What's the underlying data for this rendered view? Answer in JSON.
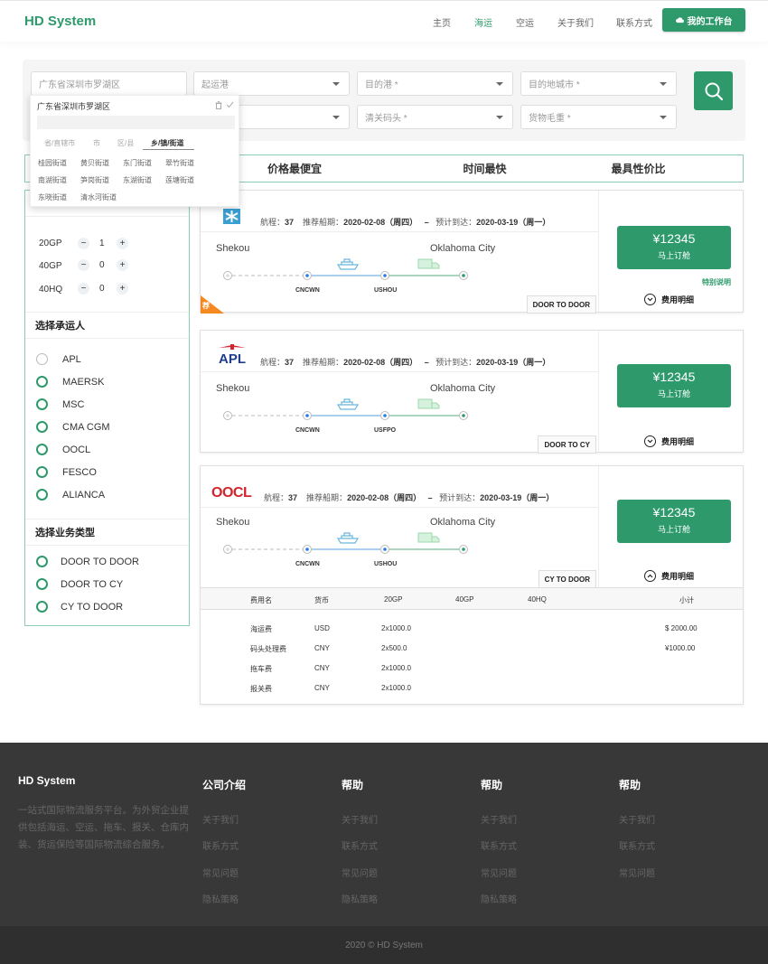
{
  "header": {
    "logo": "HD System",
    "nav": [
      {
        "label": "主页",
        "active": false
      },
      {
        "label": "海运",
        "active": true
      },
      {
        "label": "空运",
        "active": false
      },
      {
        "label": "关于我们",
        "active": false
      },
      {
        "label": "联系方式",
        "active": false
      }
    ],
    "workbench_label": "我的工作台",
    "accent_color": "#2e9a6c"
  },
  "search": {
    "origin_value": "广东省深圳市罗湖区",
    "origin_port_placeholder": "起运港",
    "dest_port_placeholder": "目的港 *",
    "dest_city_placeholder": "目的地城市 *",
    "row2_first_placeholder": "",
    "customs_placeholder": "清关码头 *",
    "weight_placeholder": "货物毛重 *",
    "search_icon": "search-icon"
  },
  "region_dropdown": {
    "title": "广东省深圳市罗湖区",
    "tabs": [
      "省/直辖市",
      "市",
      "区/县",
      "乡/镇/街道"
    ],
    "active_tab": 3,
    "items": [
      "桂园街道",
      "黄贝街道",
      "东门街道",
      "翠竹街道",
      "南湖街道",
      "笋岗街道",
      "东湖街道",
      "莲塘街道",
      "东晓街道",
      "清水河街道"
    ]
  },
  "sort_tabs": [
    "价格最便宜",
    "时间最快",
    "最具性价比"
  ],
  "sidebar": {
    "containers": [
      {
        "type": "20GP",
        "count": "1"
      },
      {
        "type": "40GP",
        "count": "0"
      },
      {
        "type": "40HQ",
        "count": "0"
      }
    ],
    "carrier_heading": "选择承运人",
    "carriers": [
      "APL",
      "MAERSK",
      "MSC",
      "CMA CGM",
      "OOCL",
      "FESCO",
      "ALIANCA"
    ],
    "business_heading": "选择业务类型",
    "business_types": [
      "DOOR TO DOOR",
      "DOOR TO CY",
      "CY TO DOOR"
    ]
  },
  "results": [
    {
      "carrier": "MAERSK",
      "voyage_label": "航程：",
      "voyage": "37",
      "sail_label": "推荐船期：",
      "sail_date": "2020-02-08（周四）",
      "dash": "–",
      "arrive_label": "预计到达：",
      "arrive_date": "2020-03-19（周一）",
      "from_city": "Shekou",
      "to_city": "Oklahoma City",
      "port1": "CNCWN",
      "port2": "USHOU",
      "service_type": "DOOR TO DOOR",
      "price": "¥12345",
      "book_label": "马上订舱",
      "special_note": "特别说明",
      "fee_toggle": "费用明细",
      "promo_badge": "荐"
    },
    {
      "carrier": "APL",
      "voyage_label": "航程：",
      "voyage": "37",
      "sail_label": "推荐船期：",
      "sail_date": "2020-02-08（周四）",
      "dash": "–",
      "arrive_label": "预计到达：",
      "arrive_date": "2020-03-19（周一）",
      "from_city": "Shekou",
      "to_city": "Oklahoma City",
      "port1": "CNCWN",
      "port2": "USFPO",
      "service_type": "DOOR TO CY",
      "price": "¥12345",
      "book_label": "马上订舱",
      "fee_toggle": "费用明细"
    },
    {
      "carrier": "OOCL",
      "voyage_label": "航程：",
      "voyage": "37",
      "sail_label": "推荐船期：",
      "sail_date": "2020-02-08（周四）",
      "dash": "–",
      "arrive_label": "预计到达：",
      "arrive_date": "2020-03-19（周一）",
      "from_city": "Shekou",
      "to_city": "Oklahoma City",
      "port1": "CNCWN",
      "port2": "USHOU",
      "service_type": "CY TO DOOR",
      "price": "¥12345",
      "book_label": "马上订舱",
      "fee_toggle": "费用明细",
      "fees": {
        "headers": [
          "费用名",
          "货币",
          "20GP",
          "40GP",
          "40HQ",
          "小计"
        ],
        "rows": [
          [
            "海运费",
            "USD",
            "2x1000.0",
            "",
            "",
            "$ 2000.00"
          ],
          [
            "码头处理费",
            "CNY",
            "2x500.0",
            "",
            "",
            "¥1000.00"
          ],
          [
            "拖车费",
            "CNY",
            "2x1000.0",
            "",
            "",
            ""
          ],
          [
            "报关费",
            "CNY",
            "2x1000.0",
            "",
            "",
            ""
          ]
        ]
      }
    }
  ],
  "footer": {
    "brand": "HD System",
    "description": "一站式国际物流服务平台。为外贸企业提供包括海运、空运、拖车、报关、仓库内装、货运保险等国际物流综合服务。",
    "columns": [
      {
        "title": "公司介绍",
        "links": [
          "关于我们",
          "联系方式",
          "常见问题",
          "隐私策略"
        ]
      },
      {
        "title": "帮助",
        "links": [
          "关于我们",
          "联系方式",
          "常见问题",
          "隐私策略"
        ]
      },
      {
        "title": "帮助",
        "links": [
          "关于我们",
          "联系方式",
          "常见问题",
          "隐私策略"
        ]
      },
      {
        "title": "帮助",
        "links": [
          "关于我们",
          "联系方式",
          "常见问题"
        ]
      }
    ],
    "copyright": "2020 © HD System"
  }
}
